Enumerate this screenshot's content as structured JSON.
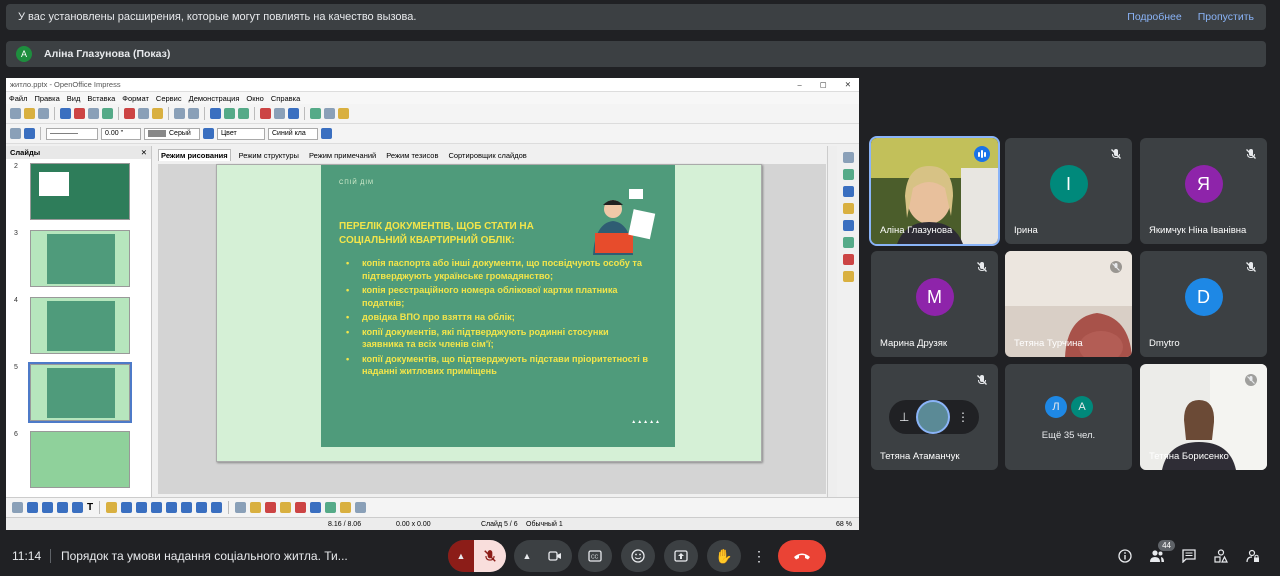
{
  "extensions_bar": {
    "message": "У вас установлены расширения, которые могут повлиять на качество вызова.",
    "more_label": "Подробнее",
    "skip_label": "Пропустить"
  },
  "presenter_bar": {
    "initial": "A",
    "label": "Аліна Глазунова (Показ)"
  },
  "impress": {
    "window_title": "житло.pptx - OpenOffice Impress",
    "menu": [
      "Файл",
      "Правка",
      "Вид",
      "Вставка",
      "Формат",
      "Сервис",
      "Демонстрация",
      "Окно",
      "Справка"
    ],
    "line_width": "0.00 \"",
    "color1": "Серый",
    "color_mode": "Цвет",
    "color2": "Синий кла",
    "slides_pane_title": "Слайды",
    "view_tabs": [
      "Режим рисования",
      "Режим структуры",
      "Режим примечаний",
      "Режим тезисов",
      "Сортировщик слайдов"
    ],
    "active_tab_index": 0,
    "thumb_numbers": [
      "2",
      "3",
      "4",
      "5",
      "6"
    ],
    "selected_thumb": "5",
    "slide": {
      "kicker": "СПІЙ ДІМ",
      "heading": "ПЕРЕЛІК ДОКУМЕНТІВ, ЩОБ СТАТИ НА СОЦІАЛЬНИЙ КВАРТИРНИЙ ОБЛІК:",
      "bullets": [
        "копія паспорта або інші документи, що посвідчують особу та підтверджують українське громадянство;",
        "копія реєстраційного номера облікової картки платника податків;",
        "довідка ВПО про взяття на облік;",
        "копії документів, які підтверджують родинні стосунки заявника та всіх членів сім'ї;",
        "копії документів, що підтверджують підстави пріоритетності в наданні житлових приміщень"
      ],
      "dots": "▲▲▲▲▲"
    },
    "status": {
      "position": "8.16 / 8.06",
      "size": "0.00 x 0.00",
      "slide": "Слайд 5 / 6",
      "layout": "Обычный 1",
      "zoom": "68 %"
    }
  },
  "participants": [
    {
      "name": "Аліна Глазунова",
      "kind": "video",
      "speaking": true
    },
    {
      "name": "Ірина",
      "initial": "І",
      "color": "#00897b"
    },
    {
      "name": "Якимчук Ніна Іванівна",
      "initial": "Я",
      "color": "#8e24aa"
    },
    {
      "name": "Марина Друзяк",
      "initial": "М",
      "color": "#8e24aa"
    },
    {
      "name": "Тетяна Турчина",
      "kind": "video"
    },
    {
      "name": "Dmytro",
      "initial": "D",
      "color": "#1e88e5"
    },
    {
      "name": "Тетяна Атаманчук",
      "kind": "avatar"
    },
    {
      "more_label": "Ещё 35 чел.",
      "initials": [
        "Л",
        "А"
      ]
    },
    {
      "name": "Тетяна Борисенко",
      "kind": "video"
    }
  ],
  "meet_bar": {
    "time": "11:14",
    "meeting_title": "Порядок та умови надання соціального житла. Ти...",
    "people_count": "44"
  },
  "colors": {
    "accent": "#8ab4f8",
    "end_call": "#ea4335",
    "muted": "#f9dedc"
  }
}
